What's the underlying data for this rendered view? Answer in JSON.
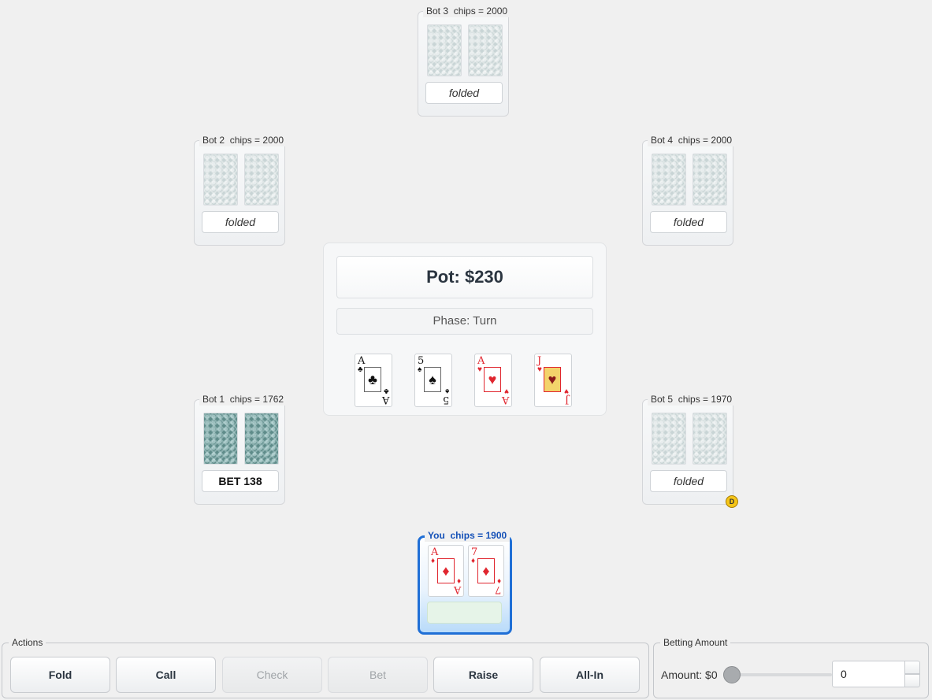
{
  "seats": {
    "bot3": {
      "name": "Bot 3",
      "chips_text": "chips = 2000",
      "status": "folded"
    },
    "bot2": {
      "name": "Bot 2",
      "chips_text": "chips = 2000",
      "status": "folded"
    },
    "bot4": {
      "name": "Bot 4",
      "chips_text": "chips = 2000",
      "status": "folded"
    },
    "bot1": {
      "name": "Bot 1",
      "chips_text": "chips = 1762",
      "status": "BET 138"
    },
    "bot5": {
      "name": "Bot 5",
      "chips_text": "chips = 1970",
      "status": "folded"
    },
    "you": {
      "name": "You",
      "chips_text": "chips = 1900",
      "status": ""
    }
  },
  "player_cards": [
    {
      "rank": "A",
      "suit": "♦",
      "color": "red"
    },
    {
      "rank": "7",
      "suit": "♦",
      "color": "red"
    }
  ],
  "board": {
    "pot": "Pot: $230",
    "phase": "Phase: Turn",
    "cards": [
      {
        "rank": "A",
        "suit": "♣",
        "color": "black"
      },
      {
        "rank": "5",
        "suit": "♠",
        "color": "black"
      },
      {
        "rank": "A",
        "suit": "♥",
        "color": "red"
      },
      {
        "rank": "J",
        "suit": "♥",
        "color": "red"
      }
    ]
  },
  "dealer_label": "D",
  "actions": {
    "legend": "Actions",
    "fold": "Fold",
    "call": "Call",
    "check": "Check",
    "bet": "Bet",
    "raise": "Raise",
    "allin": "All-In"
  },
  "betting": {
    "legend": "Betting Amount",
    "amount_label": "Amount: $0",
    "value": "0",
    "slider_fraction": 0
  },
  "colors": {
    "player_border": "#1f6fd6",
    "player_label": "#1652b8",
    "dealer_chip": "#f5c518",
    "red_suit": "#e0262f"
  }
}
